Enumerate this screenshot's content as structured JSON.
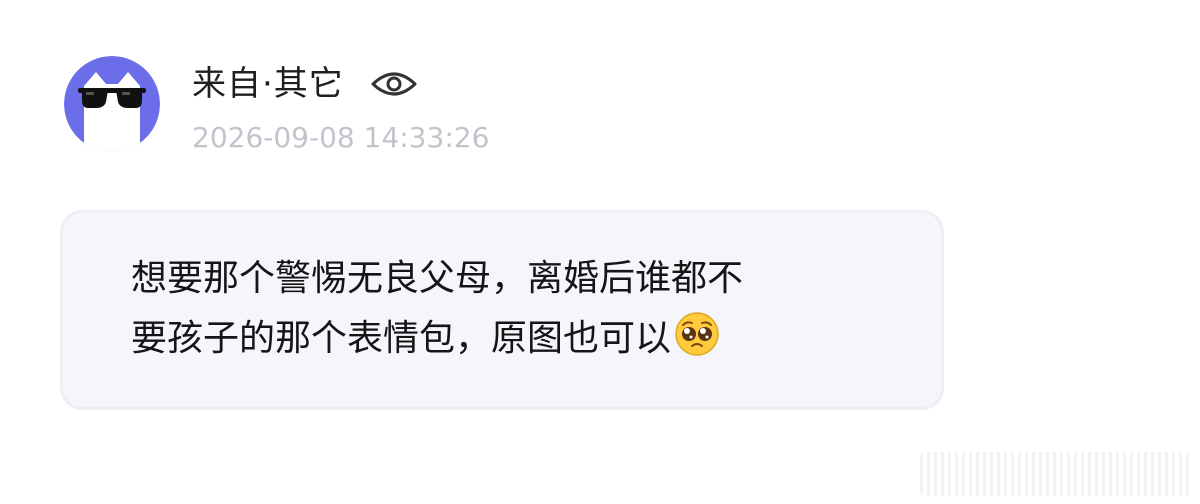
{
  "post": {
    "sender": "来自·其它",
    "timestamp": "2026-09-08 14:33:26",
    "avatar_icon": "cat-with-sunglasses-icon",
    "view_icon": "eye-icon",
    "message_lines": [
      "想要那个警惕无良父母，离婚后谁都不",
      "要孩子的那个表情包，原图也可以"
    ],
    "message_emoji": "pleading-face-emoji-icon"
  },
  "colors": {
    "avatar_bg": "#6b6ee8",
    "bubble_bg": "#f4f6fb",
    "timestamp": "#c2c4cc"
  }
}
